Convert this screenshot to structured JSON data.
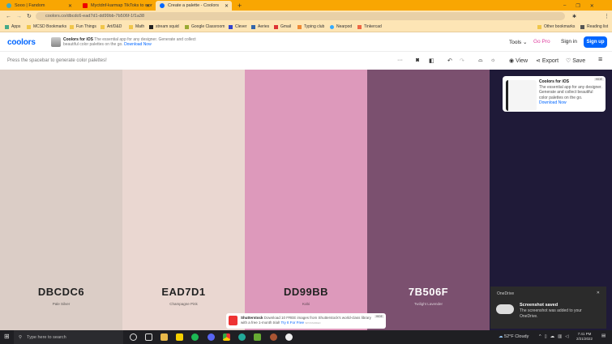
{
  "browser": {
    "tabs": [
      {
        "label": "Sooo | Fandom",
        "active": false
      },
      {
        "label": "Myctdnf-karmap TikToks to wor",
        "active": false
      },
      {
        "label": "Create a palette - Coolors",
        "active": true
      }
    ],
    "new_tab": "+",
    "url": "coolors.co/dbcdc6-ead7d1-dd99bb-7b506f-1f1a38",
    "bookmarks": [
      "Apps",
      "MCSD Bookmarks",
      "Fun Things",
      "Art/D&D",
      "Math",
      "stream squid",
      "Google Classroom",
      "Clever",
      "Aeries",
      "Gmail",
      "Typing club",
      "Nearpod",
      "Tinkercad"
    ],
    "other_bookmarks": "Other bookmarks",
    "reading_list": "Reading list"
  },
  "header": {
    "logo": "coolors",
    "ios_title": "Coolors for iOS",
    "ios_text": "The essential app for any designer. Generate and collect beautiful color palettes on the go.",
    "ios_link": "Download Now",
    "tools": "Tools",
    "go_pro": "Go Pro",
    "sign_in": "Sign in",
    "sign_up": "Sign up"
  },
  "toolbar": {
    "hint": "Press the spacebar to generate color palettes!",
    "more": "···",
    "view": "View",
    "export": "Export",
    "save": "Save"
  },
  "palette": [
    {
      "hex": "DBCDC6",
      "name": "Pale Silver",
      "color": "#DBCDC6",
      "text": "#222"
    },
    {
      "hex": "EAD7D1",
      "name": "Champagne Pink",
      "color": "#EAD7D1",
      "text": "#222"
    },
    {
      "hex": "DD99BB",
      "name": "Kobi",
      "color": "#DD99BB",
      "text": "#222"
    },
    {
      "hex": "7B506F",
      "name": "Twilight Lavender",
      "color": "#7B506F",
      "text": "#fff"
    },
    {
      "hex": "",
      "name": "",
      "color": "#1F1A38",
      "text": "#fff"
    }
  ],
  "ad": {
    "title": "Coolors for iOS",
    "text": "The essential app for any designer. Generate and collect beautiful color palettes on the go.",
    "link": "Download Now",
    "hide": "HIDE"
  },
  "onedrive": {
    "app": "OneDrive",
    "title": "Screenshot saved",
    "text": "The screenshot was added to your OneDrive."
  },
  "shutterstock": {
    "title": "Shutterstock",
    "text": "Download 10 FREE images from Shutterstock's world-class library with a free 1-month trial!",
    "link": "Try It For Free",
    "tag": "SPONSORED",
    "hide": "HIDE"
  },
  "taskbar": {
    "search": "Type here to search",
    "weather": "52°F  Cloudy",
    "time": "7:41 PM",
    "date": "2/21/2022"
  }
}
